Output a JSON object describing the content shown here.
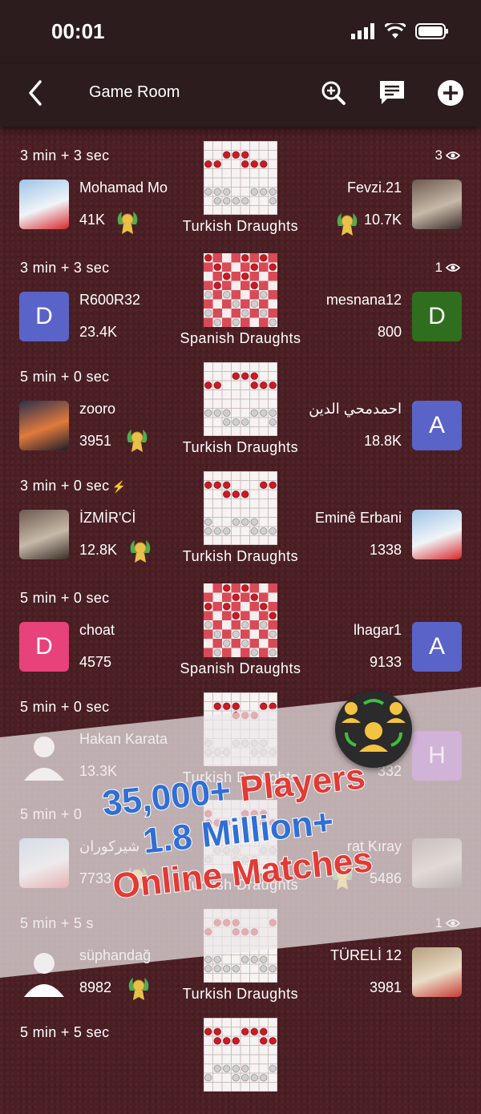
{
  "status": {
    "time": "00:01"
  },
  "header": {
    "title": "Game Room"
  },
  "promo": {
    "line1a": "35,000+",
    "line1b": "Players",
    "line2": "1.8 Million+",
    "line3": "Online Matches"
  },
  "games": [
    {
      "time_control": "3 min + 3 sec",
      "viewers": "3",
      "left_name": "Mohamad Mo",
      "left_rating": "41K",
      "right_name": "Fevzi.21",
      "right_rating": "10.7K",
      "game": "Turkish Draughts",
      "left_avatar": "photo-flag",
      "right_avatar": "photo-man"
    },
    {
      "time_control": "3 min + 3 sec",
      "viewers": "1",
      "left_name": "R600R32",
      "left_rating": "23.4K",
      "right_name": "mesnana12",
      "right_rating": "800",
      "game": "Spanish Draughts",
      "left_initial": "D",
      "right_initial": "D",
      "left_color": "#5a63c8",
      "right_color": "#2e6e1e"
    },
    {
      "time_control": "5 min + 0 sec",
      "viewers": "",
      "left_name": "zooro",
      "left_rating": "3951",
      "right_name": "احمدمحي الدين",
      "right_rating": "18.8K",
      "game": "Turkish Draughts",
      "right_initial": "A",
      "right_color": "#5a63c8"
    },
    {
      "time_control": "3 min + 0 sec",
      "viewers": "",
      "left_name": "İZMİR'Cİ",
      "left_rating": "12.8K",
      "right_name": "Eminê Erbani",
      "right_rating": "1338",
      "game": "Turkish Draughts"
    },
    {
      "time_control": "5 min + 0 sec",
      "viewers": "",
      "left_name": "choat",
      "left_rating": "4575",
      "right_name": "lhagar1",
      "right_rating": "9133",
      "game": "Spanish Draughts",
      "left_initial": "D",
      "right_initial": "A",
      "left_color": "#e7427a",
      "right_color": "#5a63c8"
    },
    {
      "time_control": "5 min + 0 sec",
      "viewers": "",
      "left_name": "Hakan Karata",
      "left_rating": "13.3K",
      "right_name": "DA",
      "right_rating": "332",
      "game": "Turkish Draughts",
      "right_initial": "H",
      "right_color": "#8e2fb0"
    },
    {
      "time_control": "5 min + 0",
      "viewers": "",
      "left_name": "شيركوران",
      "left_rating": "7733",
      "right_name": "rat Kıray",
      "right_rating": "5486",
      "game": "Turkish Draughts"
    },
    {
      "time_control": "5 min + 5 s",
      "viewers": "1",
      "left_name": "süphandağ",
      "left_rating": "8982",
      "right_name": "TÜRELİ 12",
      "right_rating": "3981",
      "game": "Turkish Draughts"
    },
    {
      "time_control": "5 min + 5 sec",
      "viewers": "",
      "left_name": "",
      "left_rating": "",
      "right_name": "",
      "right_rating": "",
      "game": ""
    }
  ]
}
